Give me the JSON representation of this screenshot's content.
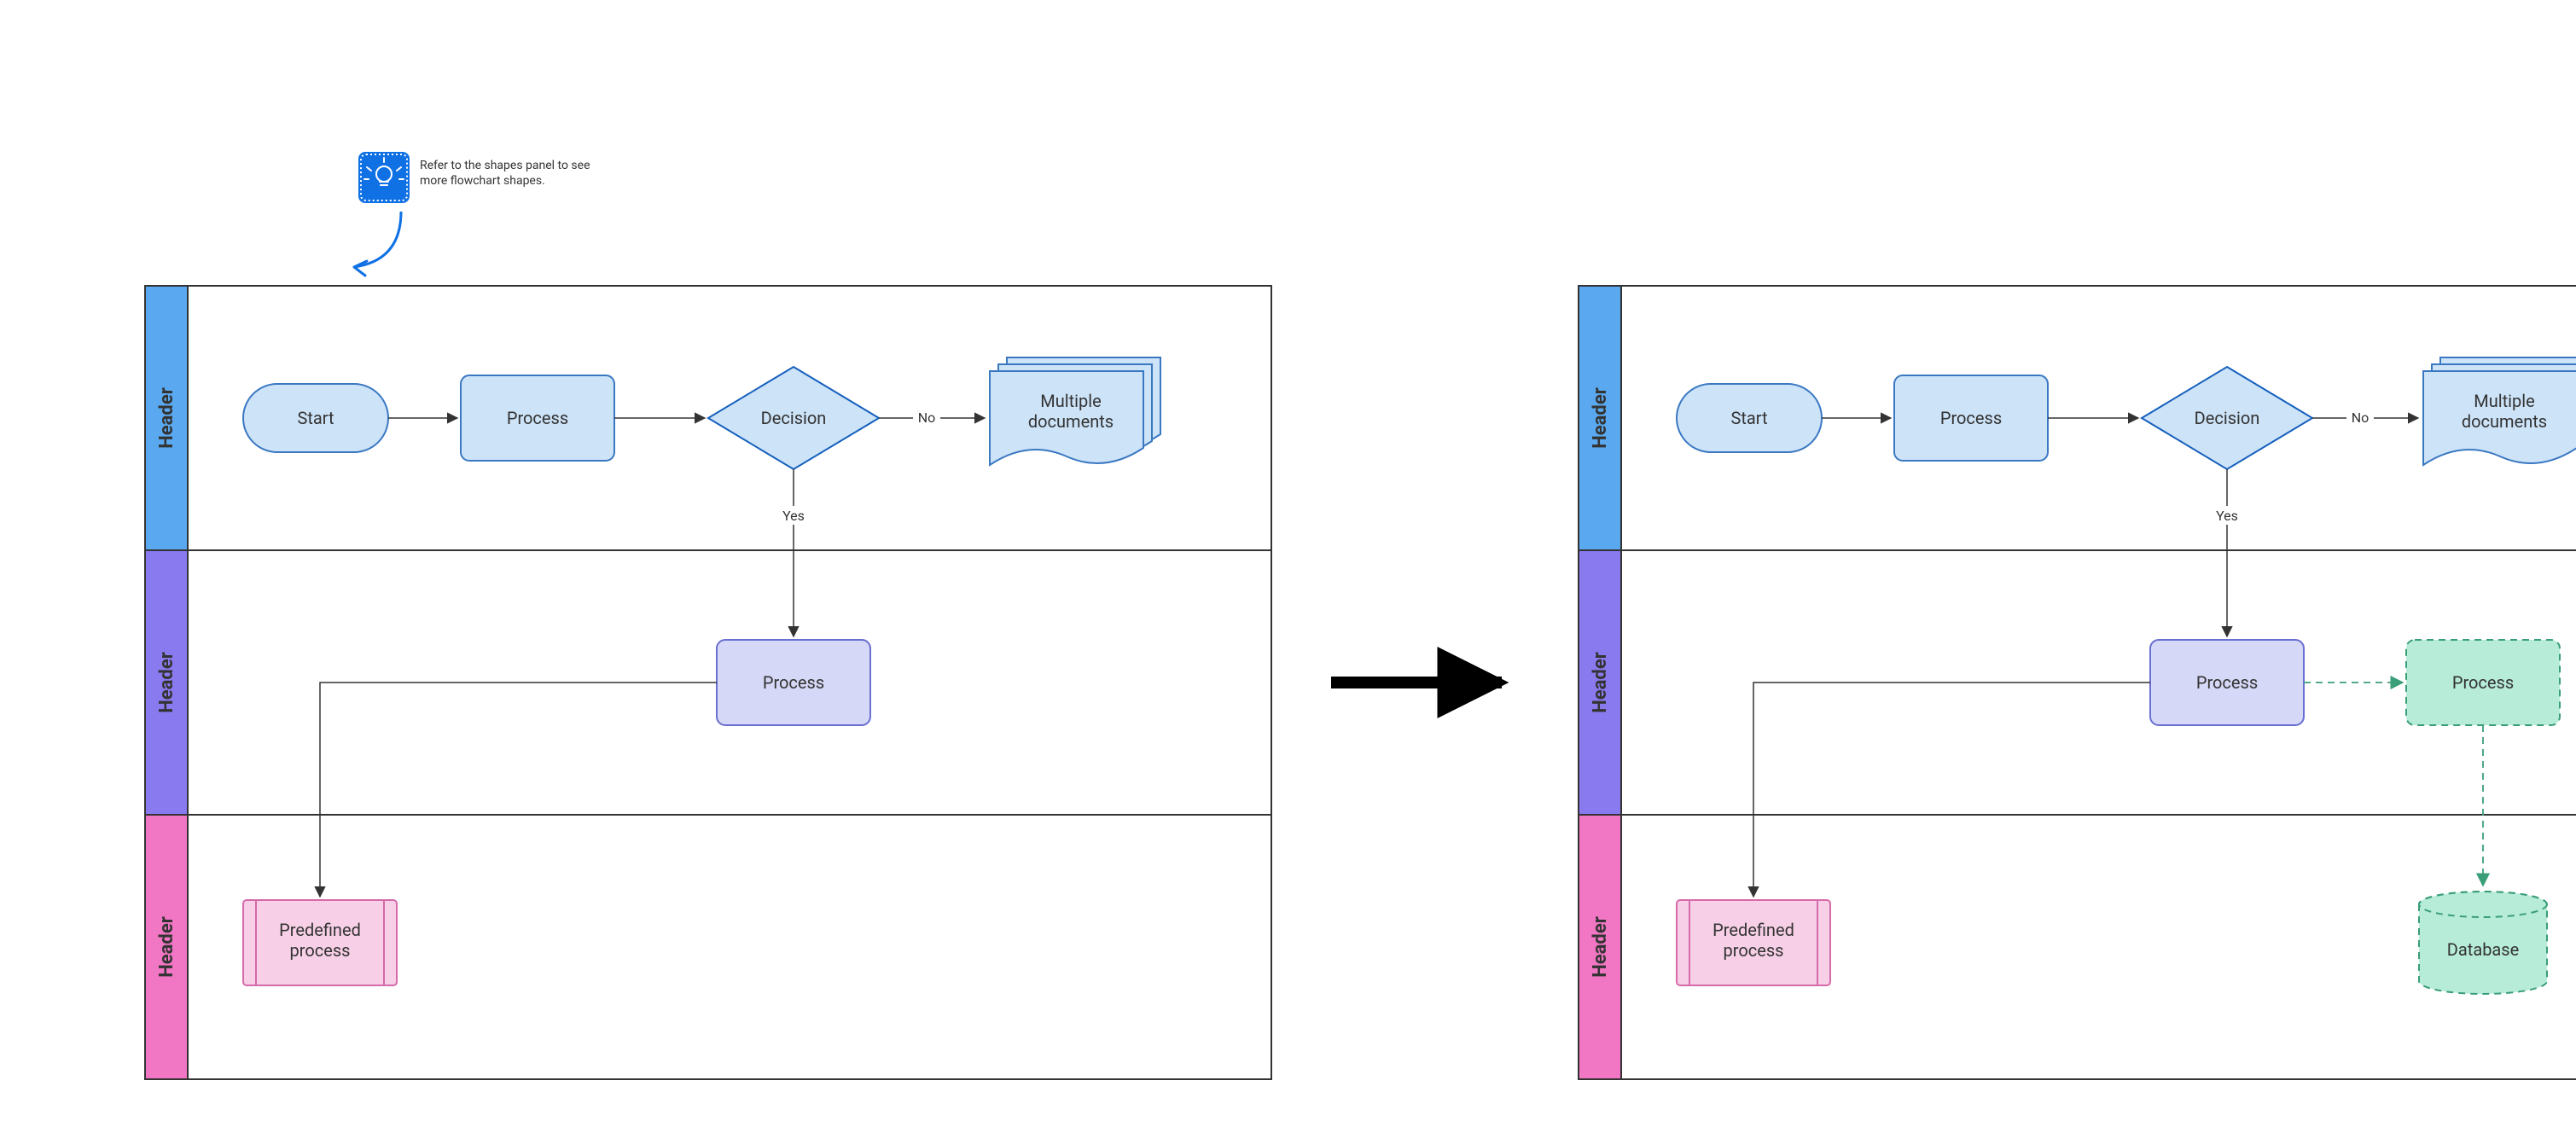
{
  "tip": {
    "line1": "Refer to the shapes panel to see",
    "line2": "more flowchart shapes."
  },
  "lanes": {
    "header1": "Header",
    "header2": "Header",
    "header3": "Header"
  },
  "nodes": {
    "start": "Start",
    "process_top": "Process",
    "decision": "Decision",
    "multi_docs_l1": "Multiple",
    "multi_docs_l2": "documents",
    "process_mid": "Process",
    "predef_l1": "Predefined",
    "predef_l2": "process",
    "newProcess": "Process",
    "database": "Database"
  },
  "edges": {
    "no": "No",
    "yes": "Yes"
  },
  "chart_data": {
    "type": "flowchart-swimlane-comparison",
    "lanes": [
      "Header",
      "Header",
      "Header"
    ],
    "left": {
      "nodes": [
        {
          "id": "start",
          "type": "terminator",
          "lane": 0,
          "label": "Start"
        },
        {
          "id": "proc1",
          "type": "process",
          "lane": 0,
          "label": "Process"
        },
        {
          "id": "dec",
          "type": "decision",
          "lane": 0,
          "label": "Decision"
        },
        {
          "id": "mdoc",
          "type": "multi-document",
          "lane": 0,
          "label": "Multiple documents"
        },
        {
          "id": "proc2",
          "type": "process",
          "lane": 1,
          "label": "Process"
        },
        {
          "id": "predef",
          "type": "predefined-process",
          "lane": 2,
          "label": "Predefined process"
        }
      ],
      "edges": [
        {
          "from": "start",
          "to": "proc1"
        },
        {
          "from": "proc1",
          "to": "dec"
        },
        {
          "from": "dec",
          "to": "mdoc",
          "label": "No"
        },
        {
          "from": "dec",
          "to": "proc2",
          "label": "Yes"
        },
        {
          "from": "proc2",
          "to": "predef"
        }
      ]
    },
    "right": {
      "nodes": [
        {
          "id": "start",
          "type": "terminator",
          "lane": 0,
          "label": "Start"
        },
        {
          "id": "proc1",
          "type": "process",
          "lane": 0,
          "label": "Process"
        },
        {
          "id": "dec",
          "type": "decision",
          "lane": 0,
          "label": "Decision"
        },
        {
          "id": "mdoc",
          "type": "multi-document",
          "lane": 0,
          "label": "Multiple documents"
        },
        {
          "id": "proc2",
          "type": "process",
          "lane": 1,
          "label": "Process"
        },
        {
          "id": "newProc",
          "type": "process",
          "lane": 1,
          "label": "Process",
          "new": true
        },
        {
          "id": "predef",
          "type": "predefined-process",
          "lane": 2,
          "label": "Predefined process"
        },
        {
          "id": "db",
          "type": "database",
          "lane": 2,
          "label": "Database",
          "new": true
        }
      ],
      "edges": [
        {
          "from": "start",
          "to": "proc1"
        },
        {
          "from": "proc1",
          "to": "dec"
        },
        {
          "from": "dec",
          "to": "mdoc",
          "label": "No"
        },
        {
          "from": "dec",
          "to": "proc2",
          "label": "Yes"
        },
        {
          "from": "proc2",
          "to": "newProc",
          "new": true
        },
        {
          "from": "newProc",
          "to": "db",
          "new": true
        },
        {
          "from": "proc2",
          "to": "predef"
        }
      ]
    }
  }
}
